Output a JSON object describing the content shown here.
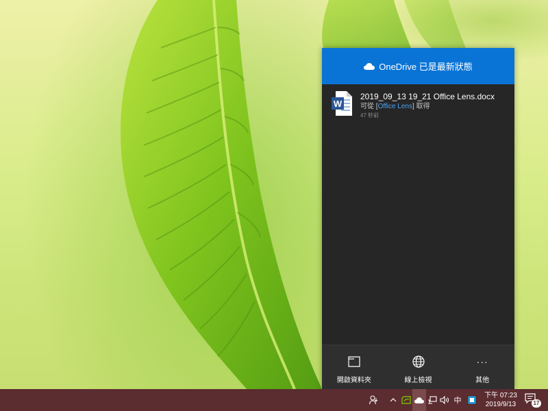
{
  "flyout": {
    "header_title": "OneDrive 已是最新狀態",
    "activity": [
      {
        "file_name": "2019_09_13 19_21 Office Lens.docx",
        "source_prefix": "可從 [",
        "source_link": "Office Lens",
        "source_suffix": "] 取得",
        "time": "47 秒前",
        "icon": "word-doc-icon"
      }
    ],
    "footer": {
      "open_folder_label": "開啟資料夾",
      "view_online_label": "線上檢視",
      "more_label": "其他",
      "more_glyph": "···"
    }
  },
  "taskbar": {
    "ime_label": "中",
    "time": "下午 07:23",
    "date": "2019/9/13",
    "notification_count": "17"
  },
  "colors": {
    "accent": "#0a74d6",
    "taskbar": "#5b2c30",
    "flyout_bg": "#262626",
    "link": "#4aa3f5"
  }
}
